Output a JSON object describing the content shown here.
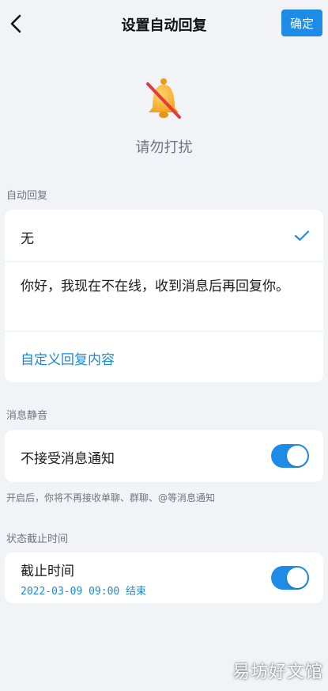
{
  "header": {
    "title": "设置自动回复",
    "confirm_label": "确定"
  },
  "status": {
    "label": "请勿打扰"
  },
  "auto_reply": {
    "section_label": "自动回复",
    "options": [
      {
        "label": "无",
        "selected": true
      },
      {
        "label": "你好，我现在不在线，收到消息后再回复你。",
        "selected": false
      }
    ],
    "custom_link": "自定义回复内容"
  },
  "mute": {
    "section_label": "消息静音",
    "toggle_label": "不接受消息通知",
    "enabled": true,
    "hint": "开启后，你将不再接收单聊、群聊、@等消息通知"
  },
  "deadline": {
    "section_label": "状态截止时间",
    "label": "截止时间",
    "value": "2022-03-09 09:00 结束",
    "enabled": true
  },
  "watermark": "易坊好文馆",
  "colors": {
    "accent": "#1e8ce6",
    "link": "#1b8ad0",
    "background": "#f2f3f6"
  },
  "icons": {
    "back": "chevron-left-icon",
    "status": "muted-bell-icon",
    "selected": "check-icon"
  }
}
